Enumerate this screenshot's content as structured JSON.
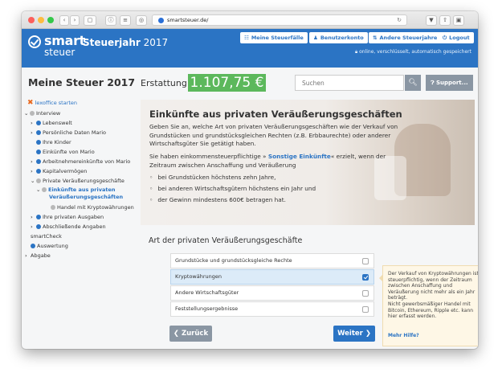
{
  "browser": {
    "url": "smartsteuer.de/",
    "colors": {
      "close": "#fc605c",
      "minimize": "#fdbc40",
      "zoom": "#34c84a"
    }
  },
  "header": {
    "logo_top": "smart",
    "logo_bottom": "steuer",
    "year_label": "Steuerjahr",
    "year_value": "2017",
    "buttons": {
      "steuerfaelle": "Meine Steuerfälle",
      "benutzerkonto": "Benutzerkonto",
      "andere_jahre": "Andere Steuerjahre",
      "logout": "Logout"
    },
    "secure_text": "online, verschlüsselt, automatisch gespeichert",
    "accent": "#2b74c4"
  },
  "topbar": {
    "title": "Meine Steuer 2017",
    "erstattung_label": "Erstattung",
    "erstattung_value": "1.107,75 €",
    "search_placeholder": "Suchen",
    "support_label": "Support..."
  },
  "sidebar": {
    "lexoffice": "lexoffice starten",
    "interview": "Interview",
    "items": {
      "lebenswelt": "Lebenswelt",
      "persoenliche": "Persönliche Daten Mario",
      "kinder": "Ihre Kinder",
      "einkuenfte_mario": "Einkünfte von Mario",
      "arbeitnehmer": "Arbeitnehmereinkünfte von Mario",
      "kapital": "Kapitalvermögen",
      "private_vg": "Private Veräußerungsgeschäfte",
      "einkuenfte_aus_1": "Einkünfte aus privaten",
      "einkuenfte_aus_2": "Veräußerungsgeschäften",
      "krypto_handel": "Handel mit Kryptowährungen",
      "ausgaben": "Ihre privaten Ausgaben",
      "abschliessende": "Abschließende Angaben",
      "smartcheck": "smartCheck",
      "auswertung": "Auswertung",
      "abgabe": "Abgabe"
    }
  },
  "hero": {
    "title": "Einkünfte aus privaten Veräußerungsgeschäften",
    "p1": [
      "Geben Sie an, welche Art von privaten Veräußerungsgeschäften wie der Verkauf von",
      "Grundstücken und grundstücksgleichen Rechten (z.B. Erbbaurechte) oder anderer",
      "Wirtschaftsgüter Sie getätigt haben."
    ],
    "p2_before": "Sie haben einkommensteuerpflichtige » ",
    "p2_link": "Sonstige Einkünfte",
    "p2_after": "« erzielt, wenn der",
    "p2_line2": "Zeitraum zwischen Anschaffung und Veräußerung",
    "bullets": [
      "bei Grundstücken höchstens zehn Jahre,",
      "bei anderen Wirtschaftsgütern höchstens ein Jahr und",
      "der Gewinn mindestens 600€ betragen hat."
    ]
  },
  "form": {
    "section_title": "Art der privaten Veräußerungsgeschäfte",
    "options": [
      {
        "label": "Grundstücke und grundstücksgleiche Rechte",
        "checked": false
      },
      {
        "label": "Kryptowährungen",
        "checked": true
      },
      {
        "label": "Andere Wirtschaftsgüter",
        "checked": false
      },
      {
        "label": "Feststellungsergebnisse",
        "checked": false
      }
    ],
    "back_label": "Zurück",
    "next_label": "Weiter"
  },
  "tip": {
    "p1": "Der Verkauf von Kryptowährungen ist steuerpflichtig, wenn der Zeitraum zwischen Anschaffung und Veräußerung nicht mehr als ein Jahr beträgt.",
    "p2": "Nicht gewerbsmäßiger Handel mit Bitcoin, Ethereum, Ripple etc. kann hier erfasst werden.",
    "link": "Mehr Hilfe?"
  }
}
